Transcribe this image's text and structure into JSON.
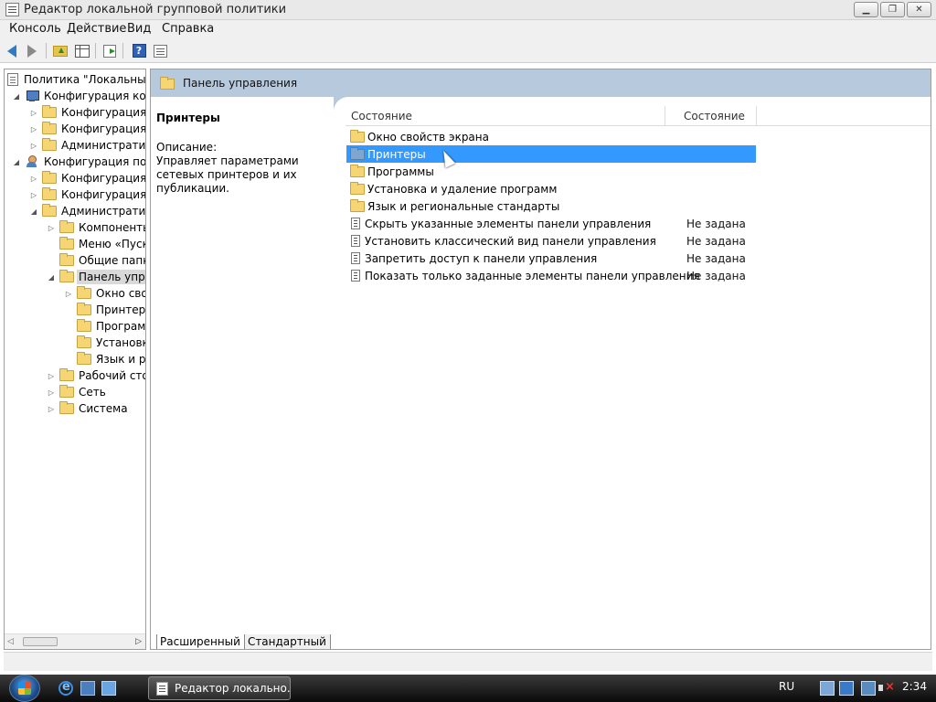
{
  "window": {
    "title": "Редактор локальной групповой политики",
    "minimize": "▁",
    "maximize": "❐",
    "close": "✕"
  },
  "menu": [
    "Консоль",
    "Действие",
    "Вид",
    "Справка"
  ],
  "toolbar": {
    "icons": [
      "back-icon",
      "forward-icon",
      "up-folder-icon",
      "show-hide-tree-icon",
      "export-list-icon",
      "help-icon",
      "properties-icon"
    ]
  },
  "tree": [
    {
      "label": "Политика \"Локальный",
      "icon": "doc",
      "level": 0,
      "expander": ""
    },
    {
      "label": "Конфигурация комп",
      "icon": "pc",
      "level": 1,
      "expander": "◢"
    },
    {
      "label": "Конфигурация п",
      "icon": "folder",
      "level": 2,
      "expander": "▷"
    },
    {
      "label": "Конфигурация W",
      "icon": "folder",
      "level": 2,
      "expander": "▷"
    },
    {
      "label": "Административ",
      "icon": "folder",
      "level": 2,
      "expander": "▷"
    },
    {
      "label": "Конфигурация поль",
      "icon": "user",
      "level": 1,
      "expander": "◢"
    },
    {
      "label": "Конфигурация п",
      "icon": "folder",
      "level": 2,
      "expander": "▷"
    },
    {
      "label": "Конфигурация W",
      "icon": "folder",
      "level": 2,
      "expander": "▷"
    },
    {
      "label": "Административ",
      "icon": "folder",
      "level": 2,
      "expander": "◢"
    },
    {
      "label": "Компоненты",
      "icon": "folder",
      "level": 3,
      "expander": "▷"
    },
    {
      "label": "Меню «Пуск",
      "icon": "folder",
      "level": 3,
      "expander": ""
    },
    {
      "label": "Общие папки",
      "icon": "folder",
      "level": 3,
      "expander": ""
    },
    {
      "label": "Панель упра",
      "icon": "folder",
      "level": 3,
      "expander": "◢",
      "selected": true
    },
    {
      "label": "Окно сво",
      "icon": "folder",
      "level": 4,
      "expander": "▷"
    },
    {
      "label": "Принтер",
      "icon": "folder",
      "level": 4,
      "expander": ""
    },
    {
      "label": "Програм",
      "icon": "folder",
      "level": 4,
      "expander": ""
    },
    {
      "label": "Установк",
      "icon": "folder",
      "level": 4,
      "expander": ""
    },
    {
      "label": "Язык и ре",
      "icon": "folder",
      "level": 4,
      "expander": ""
    },
    {
      "label": "Рабочий сто",
      "icon": "folder",
      "level": 3,
      "expander": "▷"
    },
    {
      "label": "Сеть",
      "icon": "folder",
      "level": 3,
      "expander": "▷"
    },
    {
      "label": "Система",
      "icon": "folder",
      "level": 3,
      "expander": "▷"
    }
  ],
  "tree_scroll": {
    "left": "◁",
    "right": "▷"
  },
  "pane_header": {
    "title": "Панель управления"
  },
  "description": {
    "title": "Принтеры",
    "label": "Описание:",
    "text": "Управляет параметрами сетевых принтеров и их публикации."
  },
  "list": {
    "columns": [
      "Состояние",
      "Состояние"
    ],
    "rows": [
      {
        "name": "Окно свойств экрана",
        "state": "",
        "type": "folder"
      },
      {
        "name": "Принтеры",
        "state": "",
        "type": "folder",
        "selected": true
      },
      {
        "name": "Программы",
        "state": "",
        "type": "folder"
      },
      {
        "name": "Установка и удаление программ",
        "state": "",
        "type": "folder"
      },
      {
        "name": "Язык и региональные стандарты",
        "state": "",
        "type": "folder"
      },
      {
        "name": "Скрыть указанные элементы панели управления",
        "state": "Не задана",
        "type": "setting"
      },
      {
        "name": "Установить классический вид панели управления",
        "state": "Не задана",
        "type": "setting"
      },
      {
        "name": "Запретить доступ к панели управления",
        "state": "Не задана",
        "type": "setting"
      },
      {
        "name": "Показать только заданные элементы панели управления",
        "state": "Не задана",
        "type": "setting"
      }
    ]
  },
  "tabs": [
    "Расширенный",
    "Стандартный"
  ],
  "taskbar": {
    "task_label": "Редактор локально...",
    "language": "RU",
    "clock": "2:34"
  }
}
